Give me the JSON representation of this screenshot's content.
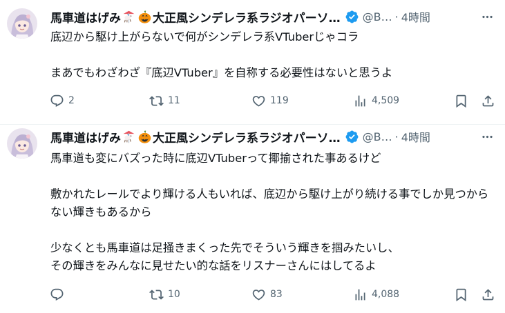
{
  "colors": {
    "text": "#0f1419",
    "secondary": "#536471",
    "verified": "#1d9bf0",
    "divider": "#eff3f4"
  },
  "tweets": [
    {
      "author": {
        "name_part1": "馬車道はげみ",
        "emoji1": "carousel-horse",
        "emoji2": "jack-o-lantern",
        "name_part2": "大正風シンデレラ系ラジオパーソ…",
        "verified": true,
        "handle": "@B…",
        "separator": "·",
        "time": "4時間"
      },
      "paragraphs": [
        "底辺から駆け上がらないで何がシンデレラ系VTuberじゃコラ",
        "",
        "まあでもわざわざ『底辺VTuber』を自称する必要性はないと思うよ"
      ],
      "stats": {
        "replies": "2",
        "reposts": "11",
        "likes": "119",
        "views": "4,509"
      }
    },
    {
      "author": {
        "name_part1": "馬車道はげみ",
        "emoji1": "carousel-horse",
        "emoji2": "jack-o-lantern",
        "name_part2": "大正風シンデレラ系ラジオパーソ…",
        "verified": true,
        "handle": "@B…",
        "separator": "·",
        "time": "4時間"
      },
      "paragraphs": [
        "馬車道も変にバズった時に底辺VTuberって揶揄された事あるけど",
        "",
        "敷かれたレールでより輝ける人もいれば、底辺から駆け上がり続ける事でしか見つからない輝きもあるから",
        "",
        "少なくとも馬車道は足掻きまくった先でそういう輝きを掴みたいし、",
        "その輝きをみんなに見せたい的な話をリスナーさんにはしてるよ"
      ],
      "stats": {
        "replies": "",
        "reposts": "10",
        "likes": "83",
        "views": "4,088"
      }
    }
  ]
}
